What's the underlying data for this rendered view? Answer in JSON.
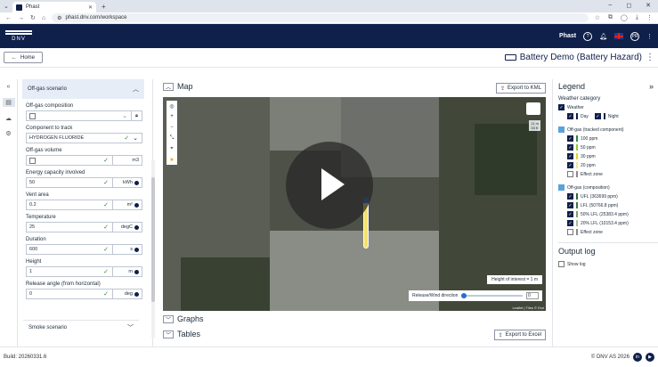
{
  "browser": {
    "tab_title": "Phast",
    "url": "phast.dnv.com/workspace",
    "window_controls": [
      "–",
      "◻",
      "✕"
    ]
  },
  "header": {
    "logo_text": "DNV",
    "product": "Phast",
    "user_initials": "PR"
  },
  "workspace": {
    "home_label": "Home",
    "title": "Battery Demo (Battery Hazard)"
  },
  "panel": {
    "section_title": "Off-gas scenario",
    "fields": [
      {
        "label": "Off-gas composition",
        "value": "",
        "unit": ""
      },
      {
        "label": "Component to track",
        "value": "HYDROGEN FLUORIDE",
        "unit": ""
      },
      {
        "label": "Off-gas volume",
        "value": "",
        "unit": "m3"
      },
      {
        "label": "Energy capacity involved",
        "value": "50",
        "unit": "kWh"
      },
      {
        "label": "Vent area",
        "value": "0.2",
        "unit": "m²"
      },
      {
        "label": "Temperature",
        "value": "25",
        "unit": "degC"
      },
      {
        "label": "Duration",
        "value": "600",
        "unit": "s"
      },
      {
        "label": "Height",
        "value": "1",
        "unit": "m"
      },
      {
        "label": "Release angle (from horizontal)",
        "value": "0",
        "unit": "deg"
      }
    ],
    "smoke_label": "Smoke scenario"
  },
  "center": {
    "map_title": "Map",
    "export_kml": "Export to KML",
    "graphs_title": "Graphs",
    "tables_title": "Tables",
    "export_excel": "Export to Excel",
    "scale_text": [
      "11 m",
      "33 ft"
    ],
    "height_of_interest": "Height of interest = 1 m",
    "wind_label": "Release/Wind direction",
    "wind_value": "0",
    "attribution": "Leaflet | Tiles © Esri"
  },
  "legend": {
    "title": "Legend",
    "weather_category": "Weather category",
    "weather": "Weather",
    "day": "Day",
    "night": "Night",
    "tracked_title": "Off-gas (tracked component)",
    "tracked_items": [
      {
        "label": "100 ppm",
        "color": "#2d8a3c"
      },
      {
        "label": "50 ppm",
        "color": "#9bc43a"
      },
      {
        "label": "30 ppm",
        "color": "#e0d23a"
      },
      {
        "label": "20 ppm",
        "color": "#f1e98d"
      },
      {
        "label": "Effect zone",
        "color": "#8a8a8a"
      }
    ],
    "composition_title": "Off-gas (composition)",
    "composition_items": [
      {
        "label": "UFL (363699 ppm)",
        "color": "#2d6b34"
      },
      {
        "label": "LFL (50766.8 ppm)",
        "color": "#3d7b45"
      },
      {
        "label": "50% LFL (25383.4 ppm)",
        "color": "#7fa16a"
      },
      {
        "label": "20% LFL (10153.4 ppm)",
        "color": "#a9c095"
      },
      {
        "label": "Effect zone",
        "color": "#8a8a8a"
      }
    ],
    "output_log_title": "Output log",
    "show_log": "Show log"
  },
  "footer": {
    "build": "Build: 20260331.6",
    "copyright": "© DNV AS 2026"
  },
  "colors": {
    "brand": "#0f204b",
    "panel_header": "#e6edf7",
    "ok": "#2a8a2a"
  }
}
